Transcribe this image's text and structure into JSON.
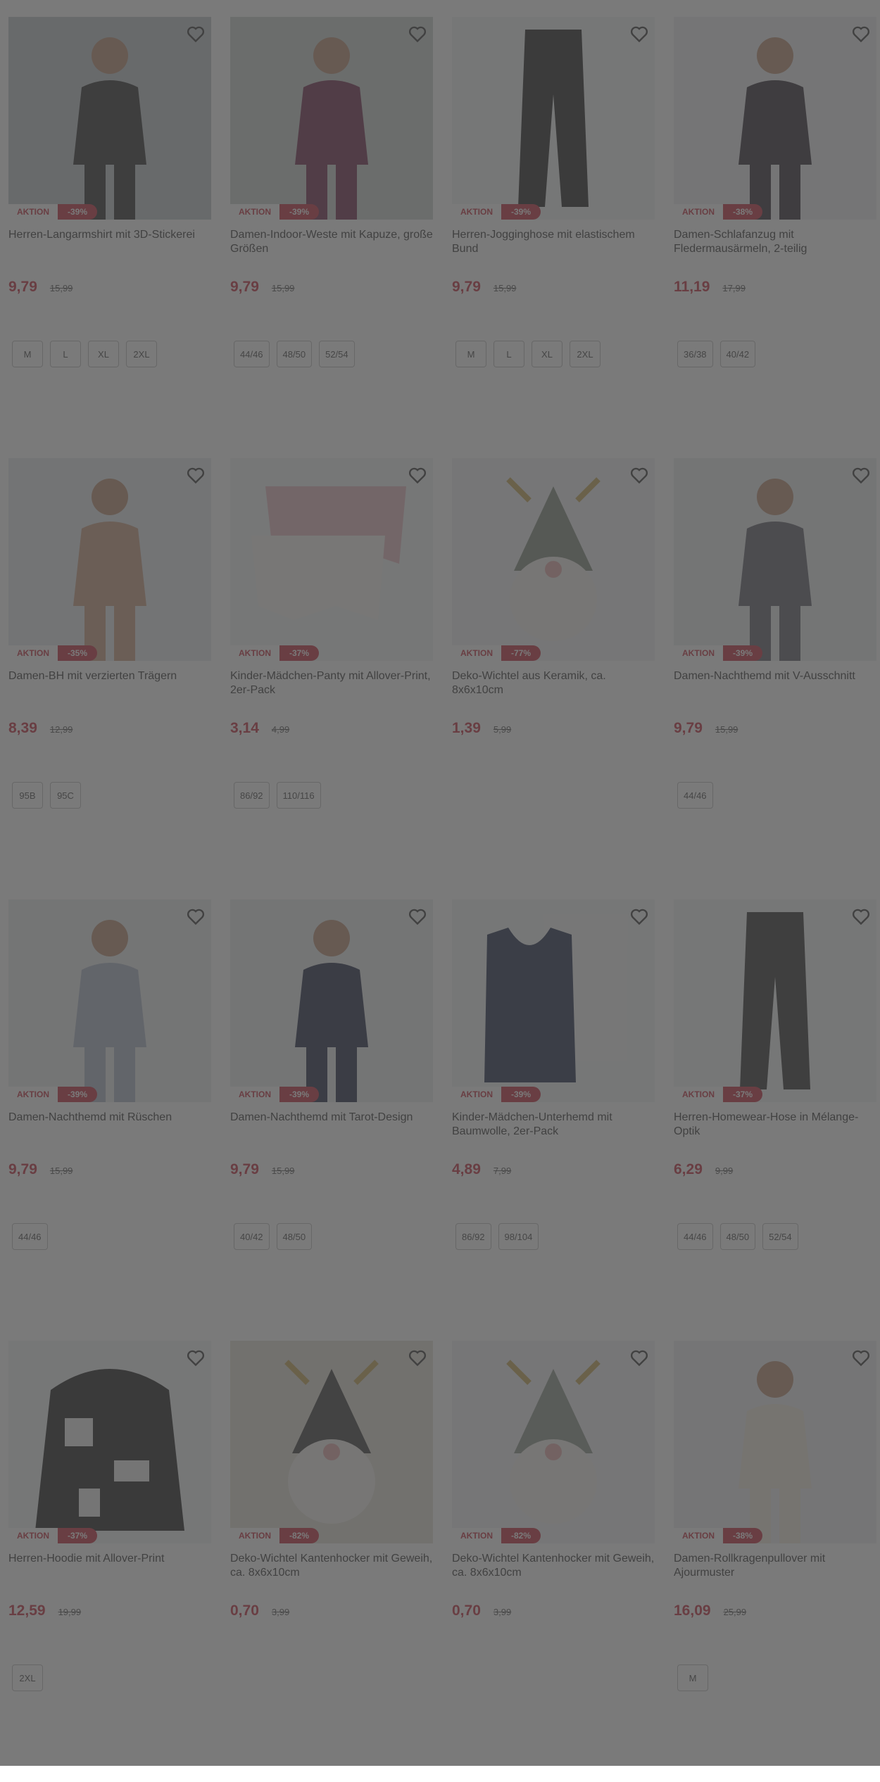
{
  "labels": {
    "aktion": "AKTION"
  },
  "products": [
    {
      "title": "Herren-Langarmshirt mit 3D-Stickerei",
      "discount": "-39%",
      "price": "9,79",
      "old_price": "15,99",
      "sizes": [
        "M",
        "L",
        "XL",
        "2XL"
      ],
      "bg": "#bfc4c8",
      "figure": "#2a2a2a",
      "kind": "person"
    },
    {
      "title": "Damen-Indoor-Weste mit Kapuze, große Größen",
      "discount": "-39%",
      "price": "9,79",
      "old_price": "15,99",
      "sizes": [
        "44/46",
        "48/50",
        "52/54"
      ],
      "bg": "#c9d0cc",
      "figure": "#6e2448",
      "kind": "person"
    },
    {
      "title": "Herren-Jogginghose mit elastischem Bund",
      "discount": "-39%",
      "price": "9,79",
      "old_price": "15,99",
      "sizes": [
        "M",
        "L",
        "XL",
        "2XL"
      ],
      "bg": "#f1f2f3",
      "figure": "#1d1d1d",
      "kind": "pants"
    },
    {
      "title": "Damen-Schlafanzug mit Fledermausärmeln, 2-teilig",
      "discount": "-38%",
      "price": "11,19",
      "old_price": "17,99",
      "sizes": [
        "36/38",
        "40/42"
      ],
      "bg": "#eceeef",
      "figure": "#2d2530",
      "kind": "person"
    },
    {
      "title": "Damen-BH mit verzierten Trägern",
      "discount": "-35%",
      "price": "8,39",
      "old_price": "12,99",
      "sizes": [
        "95B",
        "95C"
      ],
      "bg": "#e6e9eb",
      "figure": "#c99a7e",
      "kind": "person"
    },
    {
      "title": "Kinder-Mädchen-Panty mit Allover-Print, 2er-Pack",
      "discount": "-37%",
      "price": "3,14",
      "old_price": "4,99",
      "sizes": [
        "86/92",
        "110/116"
      ],
      "bg": "#f1f2f3",
      "figure": "#e7b8be",
      "kind": "panty"
    },
    {
      "title": "Deko-Wichtel aus Keramik, ca. 8x6x10cm",
      "discount": "-77%",
      "price": "1,39",
      "old_price": "5,99",
      "sizes": [],
      "bg": "#f0f1f2",
      "figure": "#7f8a7c",
      "kind": "gnome"
    },
    {
      "title": "Damen-Nachthemd mit V-Ausschnitt",
      "discount": "-39%",
      "price": "9,79",
      "old_price": "15,99",
      "sizes": [
        "44/46"
      ],
      "bg": "#e9ecee",
      "figure": "#5b5a66",
      "kind": "person"
    },
    {
      "title": "Damen-Nachthemd mit Rüschen",
      "discount": "-39%",
      "price": "9,79",
      "old_price": "15,99",
      "sizes": [
        "44/46"
      ],
      "bg": "#e9ecee",
      "figure": "#a9b2c6",
      "kind": "person"
    },
    {
      "title": "Damen-Nachthemd mit Tarot-Design",
      "discount": "-39%",
      "price": "9,79",
      "old_price": "15,99",
      "sizes": [
        "40/42",
        "48/50"
      ],
      "bg": "#e9ecee",
      "figure": "#1f2540",
      "kind": "person"
    },
    {
      "title": "Kinder-Mädchen-Unterhemd mit Baumwolle, 2er-Pack",
      "discount": "-39%",
      "price": "4,89",
      "old_price": "7,99",
      "sizes": [
        "86/92",
        "98/104"
      ],
      "bg": "#f1f2f3",
      "figure": "#1d2a4a",
      "kind": "tank"
    },
    {
      "title": "Herren-Homewear-Hose in Mélange-Optik",
      "discount": "-37%",
      "price": "6,29",
      "old_price": "9,99",
      "sizes": [
        "44/46",
        "48/50",
        "52/54"
      ],
      "bg": "#f1f2f3",
      "figure": "#2b2b2b",
      "kind": "pants"
    },
    {
      "title": "Herren-Hoodie mit Allover-Print",
      "discount": "-37%",
      "price": "12,59",
      "old_price": "19,99",
      "sizes": [
        "2XL"
      ],
      "bg": "#f1f2f3",
      "figure": "#1a1a1a",
      "kind": "hoodie"
    },
    {
      "title": "Deko-Wichtel Kantenhocker mit Geweih, ca. 8x6x10cm",
      "discount": "-82%",
      "price": "0,70",
      "old_price": "3,99",
      "sizes": [],
      "bg": "#e3ddd2",
      "figure": "#3a3a3a",
      "kind": "gnome"
    },
    {
      "title": "Deko-Wichtel Kantenhocker mit Geweih, ca. 8x6x10cm",
      "discount": "-82%",
      "price": "0,70",
      "old_price": "3,99",
      "sizes": [],
      "bg": "#f0f1f2",
      "figure": "#8a9489",
      "kind": "gnome"
    },
    {
      "title": "Damen-Rollkragenpullover mit Ajourmuster",
      "discount": "-38%",
      "price": "16,09",
      "old_price": "25,99",
      "sizes": [
        "M"
      ],
      "bg": "#eceeef",
      "figure": "#efe9dc",
      "kind": "person"
    }
  ],
  "colors": {
    "accent": "#c0283a",
    "overlay": "rgba(70,70,70,0.72)"
  }
}
